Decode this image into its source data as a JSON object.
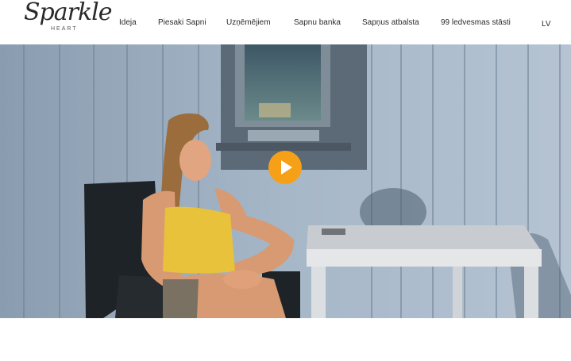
{
  "brand": {
    "logo_text": "Sparkle",
    "logo_sub": "HEART"
  },
  "nav": {
    "items": [
      {
        "label": "Ideja"
      },
      {
        "label": "Piesaki Sapni"
      },
      {
        "label": "Uzņēmējiem"
      },
      {
        "label": "Sapnu banka"
      },
      {
        "label": "Sapņus atbalsta"
      },
      {
        "label": "99 ledvesmas stāsti"
      }
    ],
    "language": "LV"
  },
  "video": {
    "play_icon": "play-icon",
    "accent": "#f5a017"
  }
}
